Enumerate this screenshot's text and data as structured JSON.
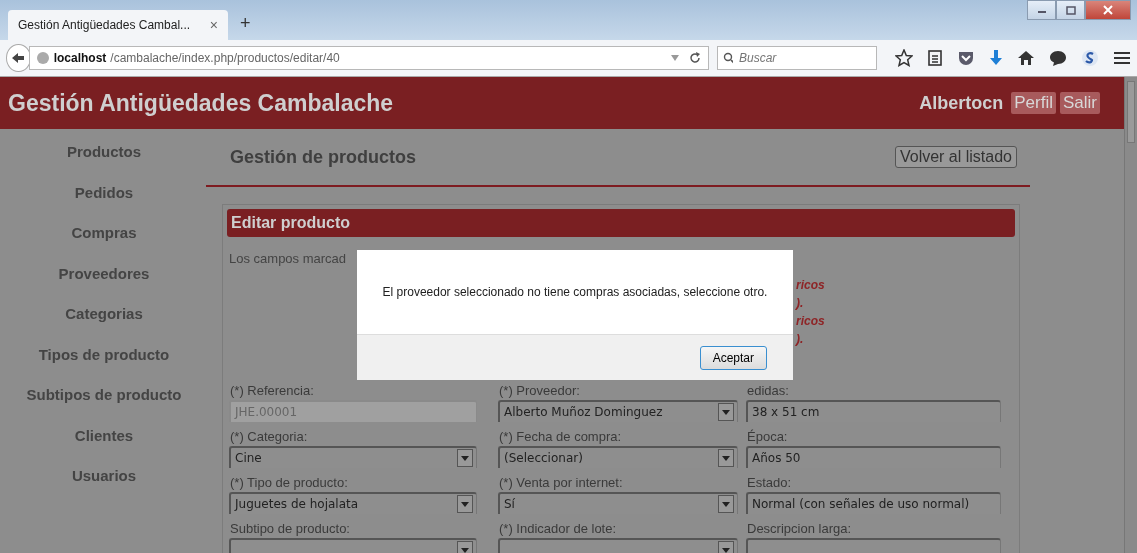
{
  "browser": {
    "tab_title": "Gestión Antigüedades Cambal...",
    "tab_close": "×",
    "new_tab": "+",
    "url_host": "localhost",
    "url_path": "/cambalache/index.php/productos/editar/40",
    "search_placeholder": "Buscar"
  },
  "header": {
    "title": "Gestión Antigüedades Cambalache",
    "user": "Albertocn",
    "buttons": [
      "Perfil",
      "Salir"
    ]
  },
  "sidebar": {
    "items": [
      "Productos",
      "Pedidos",
      "Compras",
      "Proveedores",
      "Categorias",
      "Tipos de producto",
      "Subtipos de producto",
      "Clientes",
      "Usuarios"
    ]
  },
  "content": {
    "heading": "Gestión de productos",
    "back_button": "Volver al listado",
    "panel": {
      "title": "Editar producto",
      "intro": "Los campos marcad",
      "notes": [
        "ricos",
        ").",
        "ricos",
        ")."
      ],
      "fields": [
        {
          "label": "(*) Referencia:",
          "value": "JHE.00001",
          "kind": "text",
          "disabled": true
        },
        {
          "label": "(*) Proveedor:",
          "value": "Alberto Muñoz Dominguez",
          "kind": "select",
          "disabled": false
        },
        {
          "label": "edidas:",
          "value": "38 x 51 cm",
          "kind": "text",
          "disabled": false
        },
        {
          "label": "(*) Categoria:",
          "value": "Cine",
          "kind": "select",
          "disabled": false
        },
        {
          "label": "(*) Fecha de compra:",
          "value": "(Seleccionar)",
          "kind": "select",
          "disabled": false
        },
        {
          "label": "Época:",
          "value": "Años 50",
          "kind": "text",
          "disabled": false
        },
        {
          "label": "(*) Tipo de producto:",
          "value": "Juguetes de hojalata",
          "kind": "select",
          "disabled": false
        },
        {
          "label": "(*) Venta por internet:",
          "value": "Sí",
          "kind": "select",
          "disabled": false
        },
        {
          "label": "Estado:",
          "value": "Normal (con señales de uso normal)",
          "kind": "text",
          "disabled": false
        },
        {
          "label": "Subtipo de producto:",
          "kind": "select",
          "disabled": false
        },
        {
          "label": "(*) Indicador de lote:",
          "kind": "select",
          "disabled": false
        },
        {
          "label": "Descripcion larga:",
          "kind": "text",
          "disabled": false
        }
      ]
    }
  },
  "modal": {
    "message": "El proveedor seleccionado no tiene compras asociadas, seleccione otro.",
    "button": "Aceptar"
  }
}
